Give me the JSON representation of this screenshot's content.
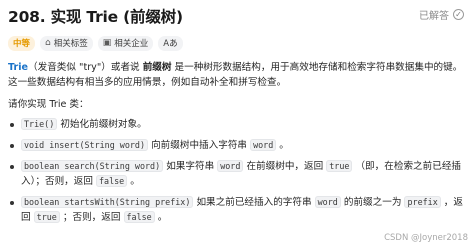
{
  "header": {
    "title": "208. 实现 Trie (前缀树)",
    "status": "已解答",
    "check_glyph": "✓"
  },
  "tags": {
    "difficulty": "中等",
    "related_tags": "相关标签",
    "related_companies": "相关企业",
    "font_toggle": "Aあ"
  },
  "description": {
    "p1_link": "Trie",
    "p1_a": "（发音类似 \"try\"）或者说 ",
    "p1_bold": "前缀树",
    "p1_b": " 是一种树形数据结构，用于高效地存储和检索字符串数据集中的键。这一些数据结构有相当多的应用情景，例如自动补全和拼写检查。",
    "intro": "请你实现 Trie 类：",
    "items": [
      {
        "code1": "Trie()",
        "text1": " 初始化前缀树对象。"
      },
      {
        "code1": "void insert(String word)",
        "text1": " 向前缀树中插入字符串 ",
        "code2": "word",
        "text2": " 。"
      },
      {
        "code1": "boolean search(String word)",
        "text1": " 如果字符串 ",
        "code2": "word",
        "text2": " 在前缀树中，返回 ",
        "code3": "true",
        "text3": " （即，在检索之前已经插入）；否则，返回 ",
        "code4": "false",
        "text4": " 。"
      },
      {
        "code1": "boolean startsWith(String prefix)",
        "text1": " 如果之前已经插入的字符串 ",
        "code2": "word",
        "text2": " 的前缀之一为 ",
        "code3": "prefix",
        "text3": " ，返回 ",
        "code4": "true",
        "text4": " ；否则，返回 ",
        "code5": "false",
        "text5": " 。"
      }
    ]
  },
  "watermark": "CSDN @Joyner2018"
}
